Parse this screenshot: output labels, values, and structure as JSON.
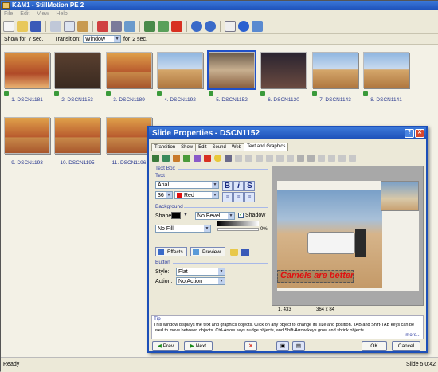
{
  "window": {
    "title": "K&M1 - StillMotion PE 2"
  },
  "menu": [
    "File",
    "Edit",
    "View",
    "Help"
  ],
  "transbar": {
    "show_for_label": "Show for",
    "show_value": "7 sec.",
    "transition_label": "Transition:",
    "transition_value": "Window",
    "for_label": "for",
    "for_value": "2 sec."
  },
  "slides": [
    {
      "label": "1. DSCN1181"
    },
    {
      "label": "2. DSCN1153"
    },
    {
      "label": "3. DSCN1189"
    },
    {
      "label": "4. DSCN1192"
    },
    {
      "label": "5. DSCN1152"
    },
    {
      "label": "6. DSCN1130"
    },
    {
      "label": "7. DSCN1143"
    },
    {
      "label": "8. DSCN1141"
    },
    {
      "label": "9. DSCN1193"
    },
    {
      "label": "10. DSCN1195"
    },
    {
      "label": "11. DSCN1196"
    }
  ],
  "statusbar": {
    "left": "Ready",
    "right": "Slide 5  0:42"
  },
  "dialog": {
    "title": "Slide Properties - DSCN1152",
    "tabs": [
      "Transition",
      "Show",
      "Edit",
      "Sound",
      "Web",
      "Text and Graphics"
    ],
    "textbox": {
      "section": "Text Box",
      "text_label": "Text",
      "font": "Arial",
      "size": "36",
      "color": "Red",
      "bold": "B",
      "italic": "i",
      "shadow_s": "S"
    },
    "background": {
      "section": "Background",
      "shape_label": "Shape",
      "bevel": "No Bevel",
      "shadow_label": "Shadow",
      "fill": "No Fill",
      "percent": "0%"
    },
    "effects_btn": "Effects",
    "preview_btn": "Preview",
    "button": {
      "section": "Button",
      "style_label": "Style:",
      "style_value": "Flat",
      "action_label": "Action:",
      "action_value": "No Action"
    },
    "slide_text": "Camels are better",
    "coords": {
      "position": "1, 433",
      "size": "364 x 84"
    },
    "tip": {
      "title": "Tip",
      "text": "This window displays the text and graphics objects. Click on any object to change its size and position. TAB and Shift-TAB keys can be used to move between objects. Ctrl-Arrow keys nudge objects, and Shift-Arrow keys grow and shrink objects.",
      "more": "more..."
    },
    "buttons": {
      "prev": "Prev",
      "next": "Next",
      "ok": "OK",
      "cancel": "Cancel"
    }
  },
  "colors": {
    "titlebar": "#1c4fb8",
    "caption_text": "#2a3a90",
    "slide_text": "#e01010"
  }
}
